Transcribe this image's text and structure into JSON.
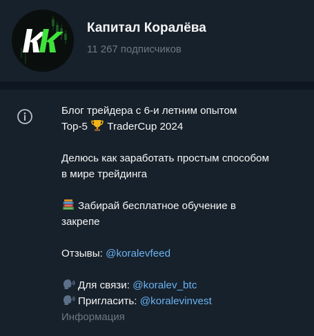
{
  "channel": {
    "title": "Капитал Коралёва",
    "subscribers": "11 267 подписчиков",
    "avatar_icon": "kk-logo-icon",
    "avatar_colors": {
      "bg": "#0a0f0d",
      "accent": "#3fe23a"
    }
  },
  "description": {
    "line1": "Блог трейдера с 6-и летним опытом",
    "line2_prefix": "Top-5",
    "line2_suffix": "TraderCup 2024",
    "line3": "Делюсь как заработать простым способом",
    "line4": "в мире трейдинга",
    "line5_text": "Забирай бесплатное обучение в",
    "line6": "закрепе",
    "reviews_label": "Отзывы:",
    "reviews_link": "@koralevfeed",
    "contact_label": "Для связи:",
    "contact_link": "@koralev_btc",
    "invite_label": "Пригласить:",
    "invite_link": "@koralevinvest",
    "icons": {
      "trophy": "trophy-icon",
      "books": "books-icon",
      "speech": "speaking-head-icon",
      "info": "info-icon"
    }
  },
  "section_caption": "Информация",
  "colors": {
    "background": "#17212b",
    "divider": "#0e1621",
    "text": "#f5f5f5",
    "muted": "#6d7883",
    "link": "#6ab3f3"
  }
}
